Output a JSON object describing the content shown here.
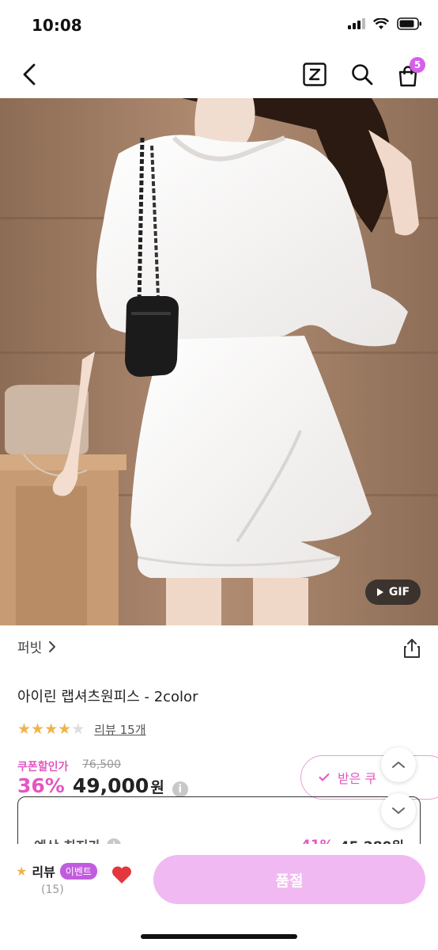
{
  "status_bar": {
    "time": "10:08"
  },
  "nav": {
    "cart_badge": "5"
  },
  "hero": {
    "gif_label": "GIF"
  },
  "product": {
    "brand": "퍼빗",
    "title": "아이린 랩셔츠원피스 - 2color",
    "rating_stars": 4,
    "review_link": "리뷰 15개",
    "coupon_price_label": "쿠폰할인가",
    "original_price": "76,500",
    "discount_percent": "36%",
    "sale_price": "49,000",
    "currency": "원",
    "coupon_button": "받은 쿠",
    "estimate": {
      "label": "예상 최저가",
      "percent": "41%",
      "price": "45,280원"
    }
  },
  "bottom_bar": {
    "review_label": "리뷰",
    "event_tag": "이벤트",
    "review_count": "(15)",
    "soldout_label": "품절"
  },
  "colors": {
    "accent_pink": "#e456c2",
    "soldout_button": "#f1b9f1",
    "star_gold": "#f0b44c",
    "heart_red": "#e5363d"
  }
}
